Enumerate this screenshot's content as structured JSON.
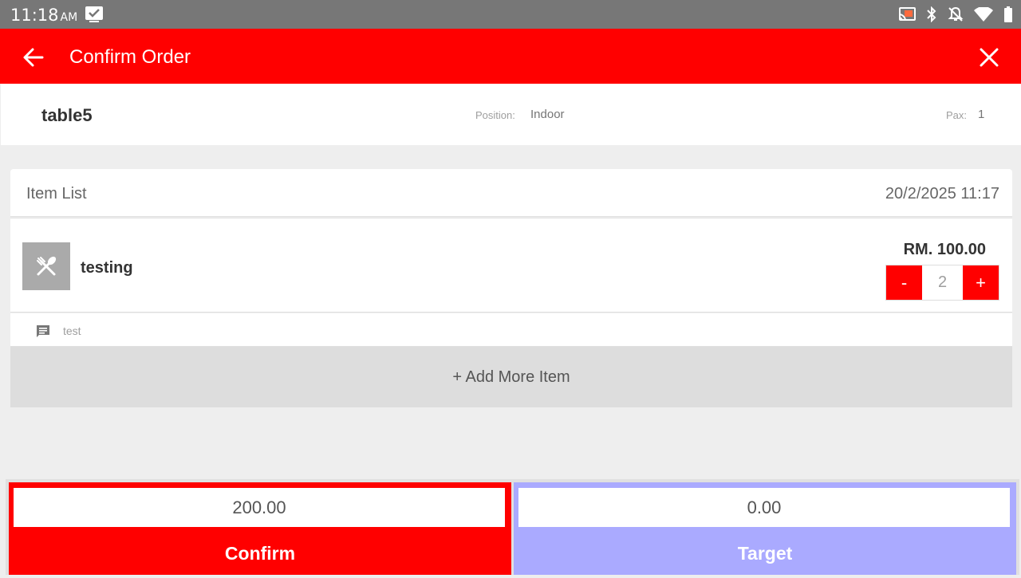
{
  "status_bar": {
    "time": "11:18",
    "ampm": "AM",
    "icons": [
      "task-check-icon",
      "cast-icon",
      "bluetooth-icon",
      "notifications-off-icon",
      "wifi-icon",
      "battery-icon"
    ]
  },
  "app_bar": {
    "title": "Confirm Order",
    "back_icon": "arrow-left-icon",
    "close_icon": "close-icon",
    "color": "#ff0000"
  },
  "table_info": {
    "name": "table5",
    "position_label": "Position:",
    "position_value": "Indoor",
    "pax_label": "Pax:",
    "pax_value": "1"
  },
  "item_list": {
    "title": "Item List",
    "date": "20/2/2025 11:17",
    "items": [
      {
        "name": "testing",
        "price": "RM. 100.00",
        "quantity": "2",
        "decrement_label": "-",
        "increment_label": "+",
        "note": "test",
        "thumb_icon": "utensils-icon"
      }
    ],
    "add_more_label": "+ Add More Item"
  },
  "footer": {
    "confirm_amount": "200.00",
    "confirm_label": "Confirm",
    "confirm_color": "#ff0000",
    "target_amount": "0.00",
    "target_label": "Target",
    "target_color": "#aaaaff"
  }
}
